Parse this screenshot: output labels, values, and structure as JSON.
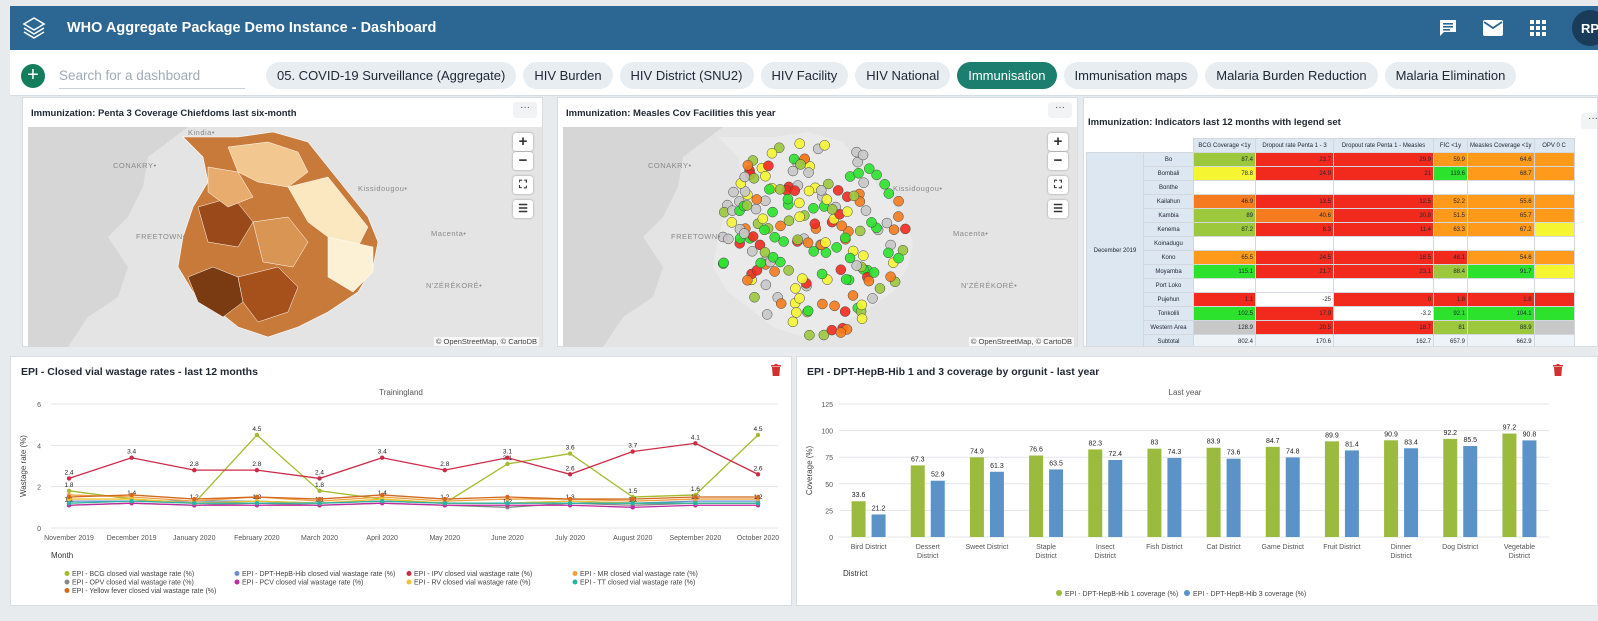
{
  "header": {
    "title": "WHO Aggregate Package Demo Instance - Dashboard",
    "avatar": "RP"
  },
  "toolbar": {
    "add_label": "+",
    "search_placeholder": "Search for a dashboard"
  },
  "tabs": [
    "05. COVID-19 Surveillance (Aggregate)",
    "HIV Burden",
    "HIV District (SNU2)",
    "HIV Facility",
    "HIV National",
    "Immunisation",
    "Immunisation maps",
    "Malaria Burden Reduction",
    "Malaria Elimination"
  ],
  "active_tab": "Immunisation",
  "colors": {
    "header": "#2c6693",
    "active_tab": "#1c7e6e",
    "line_red": "#cc2b48",
    "line_green": "#a3bb2c",
    "bar_green": "#9bbb3e",
    "bar_blue": "#5b93c8"
  },
  "map1": {
    "title": "Immunization: Penta 3 Coverage Chiefdoms last six-month",
    "attribution": "© OpenStreetMap, © CartoDB",
    "labels": [
      "Kindia•",
      "CONAKRY•",
      "FREETOWN•",
      "Kissidougou•",
      "Macenta•",
      "N'ZÉRÉKORÉ•"
    ]
  },
  "map2": {
    "title": "Immunization: Measles Cov Facilities this year",
    "attribution": "© OpenStreetMap, © CartoDB",
    "labels": [
      "CONAKRY•",
      "FREETOWN•",
      "Kissidougou•",
      "Macenta•",
      "N'ZÉRÉKORÉ•"
    ]
  },
  "table": {
    "title": "Immunization: Indicators last 12 months with legend set",
    "period": "December 2019",
    "headers": [
      "BCG Coverage <1y",
      "Dropout rate Penta 1 - 3",
      "Dropout rate Penta 1 - Measles",
      "FIC <1y",
      "Measles Coverage <1y",
      "OPV 0 C"
    ],
    "rows": [
      {
        "ou": "Bo",
        "v": [
          "87.4",
          "23.7",
          "29.9",
          "59.9",
          "64.6",
          ""
        ],
        "c": [
          "#9bc83c",
          "#f22a1e",
          "#f22a1e",
          "#ff9a1a",
          "#ff9a1a",
          "#ff9a1a"
        ]
      },
      {
        "ou": "Bombali",
        "v": [
          "78.8",
          "24.9",
          "21",
          "119.6",
          "68.7",
          ""
        ],
        "c": [
          "#f5f532",
          "#f22a1e",
          "#f22a1e",
          "#2ce22c",
          "#ff9a1a",
          "#ff9a1a"
        ]
      },
      {
        "ou": "Bonthe",
        "v": [
          "",
          "",
          "",
          "",
          "",
          ""
        ],
        "c": [
          "#fff",
          "#fff",
          "#fff",
          "#fff",
          "#fff",
          "#fff"
        ]
      },
      {
        "ou": "Kailahun",
        "v": [
          "46.9",
          "13.5",
          "12.5",
          "52.2",
          "55.6",
          ""
        ],
        "c": [
          "#f57b1e",
          "#f22a1e",
          "#f22a1e",
          "#ff9a1a",
          "#ff9a1a",
          "#ff9a1a"
        ]
      },
      {
        "ou": "Kambia",
        "v": [
          "89",
          "40.6",
          "30.8",
          "51.5",
          "65.7",
          ""
        ],
        "c": [
          "#9bc83c",
          "#f57b1e",
          "#f22a1e",
          "#ff9a1a",
          "#ff9a1a",
          "#ff9a1a"
        ]
      },
      {
        "ou": "Kenema",
        "v": [
          "87.2",
          "8.3",
          "11.4",
          "63.3",
          "67.2",
          ""
        ],
        "c": [
          "#9bc83c",
          "#f22a1e",
          "#f22a1e",
          "#ff9a1a",
          "#ff9a1a",
          "#f5f532"
        ]
      },
      {
        "ou": "Koinadugu",
        "v": [
          "",
          "",
          "",
          "",
          "",
          ""
        ],
        "c": [
          "#fff",
          "#fff",
          "#fff",
          "#fff",
          "#fff",
          "#fff"
        ]
      },
      {
        "ou": "Kono",
        "v": [
          "65.5",
          "24.5",
          "18.5",
          "48.1",
          "54.6",
          ""
        ],
        "c": [
          "#ff9a1a",
          "#f22a1e",
          "#f22a1e",
          "#f22a1e",
          "#ff9a1a",
          "#ff9a1a"
        ]
      },
      {
        "ou": "Moyamba",
        "v": [
          "115.1",
          "21.7",
          "23.1",
          "88.4",
          "91.7",
          ""
        ],
        "c": [
          "#2ce22c",
          "#f22a1e",
          "#f22a1e",
          "#9bc83c",
          "#2ce22c",
          "#f5f532"
        ]
      },
      {
        "ou": "Port Loko",
        "v": [
          "",
          "",
          "",
          "",
          "",
          ""
        ],
        "c": [
          "#fff",
          "#fff",
          "#fff",
          "#fff",
          "#fff",
          "#fff"
        ]
      },
      {
        "ou": "Pujehun",
        "v": [
          "1.1",
          "-25",
          "0",
          "1.8",
          "1.8",
          ""
        ],
        "c": [
          "#f22a1e",
          "#fff",
          "#f22a1e",
          "#f22a1e",
          "#f22a1e",
          "#f22a1e"
        ]
      },
      {
        "ou": "Tonkolili",
        "v": [
          "102.5",
          "17.9",
          "-3.2",
          "92.1",
          "104.1",
          ""
        ],
        "c": [
          "#2ce22c",
          "#f22a1e",
          "#fff",
          "#2ce22c",
          "#2ce22c",
          "#2ce22c"
        ]
      },
      {
        "ou": "Western Area",
        "v": [
          "128.9",
          "20.5",
          "18.7",
          "81",
          "88.9",
          ""
        ],
        "c": [
          "#c8c8c8",
          "#f22a1e",
          "#f22a1e",
          "#9bc83c",
          "#9bc83c",
          "#c8c8c8"
        ]
      },
      {
        "ou": "Subtotal",
        "v": [
          "802.4",
          "170.6",
          "162.7",
          "657.9",
          "662.9",
          ""
        ],
        "c": [
          "#eef3f8",
          "#eef3f8",
          "#eef3f8",
          "#eef3f8",
          "#eef3f8",
          "#eef3f8"
        ]
      }
    ]
  },
  "chart_data": [
    {
      "type": "line",
      "title": "EPI - Closed vial wastage rates - last 12 months",
      "subtitle": "Trainingland",
      "xlabel": "Month",
      "ylabel": "Wastage rate (%)",
      "ylim": [
        0,
        6
      ],
      "yticks": [
        "0",
        "2",
        "4",
        "6"
      ],
      "categories": [
        "November 2019",
        "December 2019",
        "January 2020",
        "February 2020",
        "March 2020",
        "April 2020",
        "May 2020",
        "June 2020",
        "July 2020",
        "August 2020",
        "September 2020",
        "October 2020"
      ],
      "series": [
        {
          "name": "EPI - BCG closed vial wastage rate (%)",
          "color": "#a3bb2c",
          "values": [
            1.8,
            1.4,
            1.2,
            4.5,
            1.8,
            1.4,
            1.2,
            3.1,
            3.6,
            1.5,
            1.6,
            4.5
          ],
          "labels": [
            "1.8",
            "1.4",
            "1.2",
            "4.5",
            "1.8",
            "1.4",
            "1.2",
            "3.1",
            "3.6",
            "1.5",
            "1.6",
            "4.5"
          ]
        },
        {
          "name": "EPI - DPT-HepB-Hib closed vial wastage rate (%)",
          "color": "#6a8fcc",
          "values": [
            1.3,
            1.3,
            1.3,
            1.3,
            1.2,
            1.3,
            1.2,
            1.2,
            1.3,
            1.2,
            1.3,
            1.3
          ],
          "labels": []
        },
        {
          "name": "EPI - IPV closed vial wastage rate (%)",
          "color": "#cc2b48",
          "values": [
            2.4,
            3.4,
            2.8,
            2.8,
            2.4,
            3.4,
            2.8,
            3.4,
            2.6,
            3.7,
            4.1,
            2.6
          ],
          "labels": [
            "2.4",
            "3.4",
            "2.8",
            "2.8",
            "2.4",
            "3.4",
            "2.8",
            "3.1",
            "2.6",
            "3.7",
            "4.1",
            "2.6"
          ]
        },
        {
          "name": "EPI - MR closed vial wastage rate (%)",
          "color": "#f0a040",
          "values": [
            1.6,
            1.5,
            1.3,
            1.5,
            1.3,
            1.5,
            1.3,
            1.4,
            1.4,
            1.3,
            1.4,
            1.4
          ],
          "labels": []
        },
        {
          "name": "EPI - OPV closed vial wastage rate (%)",
          "color": "#888888",
          "values": [
            1.1,
            1.2,
            1.1,
            1.2,
            1.1,
            1.2,
            1.1,
            1.0,
            1.2,
            1.1,
            1.2,
            1.2
          ],
          "labels": [
            "1.1",
            "",
            "",
            "1.2",
            "1.1",
            "",
            "",
            "1.2",
            "1.3",
            "1.1",
            "1.2",
            "1.2"
          ]
        },
        {
          "name": "EPI - PCV closed vial wastage rate (%)",
          "color": "#c02aa0",
          "values": [
            1.1,
            1.2,
            1.1,
            1.1,
            1.1,
            1.2,
            1.1,
            1.1,
            1.1,
            1.0,
            1.1,
            1.1
          ],
          "labels": []
        },
        {
          "name": "EPI - RV closed vial wastage rate (%)",
          "color": "#f2c12e",
          "values": [
            1.4,
            1.4,
            1.2,
            1.3,
            1.2,
            1.4,
            1.2,
            1.2,
            1.3,
            1.2,
            1.2,
            1.2
          ],
          "labels": []
        },
        {
          "name": "EPI - TT closed vial wastage rate (%)",
          "color": "#2ab3a0",
          "values": [
            1.2,
            1.3,
            1.2,
            1.2,
            1.2,
            1.3,
            1.2,
            1.2,
            1.2,
            1.2,
            1.2,
            1.2
          ],
          "labels": []
        },
        {
          "name": "EPI - Yellow fever closed vial wastage rate (%)",
          "color": "#d2691e",
          "values": [
            1.5,
            1.6,
            1.4,
            1.5,
            1.4,
            1.6,
            1.4,
            1.5,
            1.4,
            1.4,
            1.5,
            1.5
          ],
          "labels": []
        }
      ]
    },
    {
      "type": "bar",
      "title": "EPI - DPT-HepB-Hib 1 and 3 coverage by orgunit - last year",
      "subtitle": "Last year",
      "xlabel": "District",
      "ylabel": "Coverage (%)",
      "ylim": [
        0,
        125
      ],
      "yticks": [
        "0",
        "25",
        "50",
        "75",
        "100",
        "125"
      ],
      "categories": [
        "Bird District",
        "Dessert District",
        "Sweet District",
        "Staple District",
        "Insect District",
        "Fish District",
        "Cat District",
        "Game District",
        "Fruit District",
        "Dinner District",
        "Dog District",
        "Vegetable District"
      ],
      "series": [
        {
          "name": "EPI - DPT-HepB-Hib 1 coverage (%)",
          "color": "#9bbb3e",
          "values": [
            33.6,
            67.3,
            74.9,
            76.6,
            82.3,
            83,
            83.9,
            84.7,
            89.9,
            90.9,
            92.2,
            97.2
          ]
        },
        {
          "name": "EPI - DPT-HepB-Hib 3 coverage (%)",
          "color": "#5b93c8",
          "values": [
            21.2,
            52.9,
            61.3,
            63.5,
            72.4,
            74.3,
            73.6,
            74.8,
            81.4,
            83.4,
            85.5,
            90.8
          ]
        }
      ]
    }
  ]
}
